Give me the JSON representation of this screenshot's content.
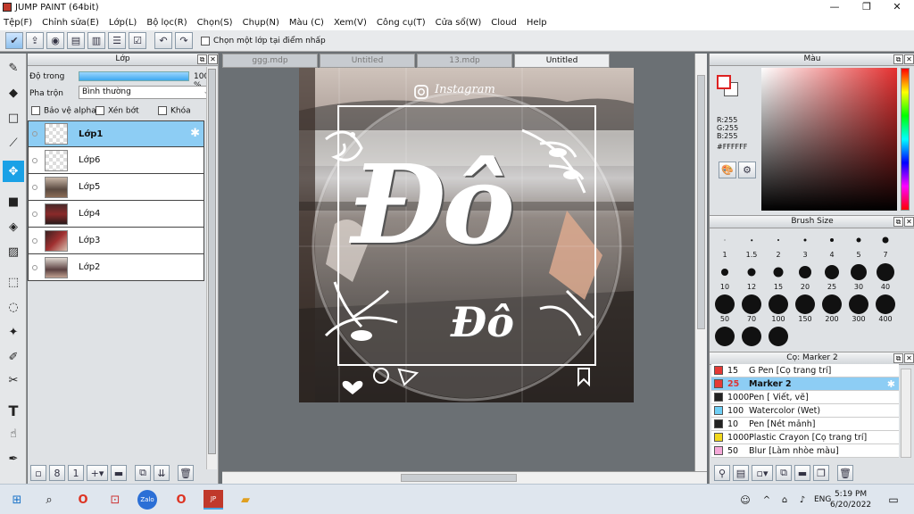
{
  "window": {
    "title": "JUMP PAINT (64bit)",
    "min": "—",
    "max": "❐",
    "close": "✕"
  },
  "menu": [
    "Tệp(F)",
    "Chỉnh sửa(E)",
    "Lớp(L)",
    "Bộ lọc(R)",
    "Chọn(S)",
    "Chụp(N)",
    "Màu (C)",
    "Xem(V)",
    "Công cụ(T)",
    "Cửa sổ(W)",
    "Cloud",
    "Help"
  ],
  "toolbar": {
    "select_layer_label": "Chọn một lớp tại điểm nhấp"
  },
  "layer_panel": {
    "title": "Lớp",
    "opacity_label": "Độ trong",
    "opacity_value": "100 %",
    "opacity_fraction": 1.0,
    "blend_label": "Pha trộn",
    "blend_value": "Bình thường",
    "protect_alpha": "Bảo vệ alpha",
    "clip": "Xén bớt",
    "lock": "Khóa",
    "layers": [
      "Lớp1",
      "Lớp6",
      "Lớp5",
      "Lớp4",
      "Lớp3",
      "Lớp2"
    ],
    "selected_layer": "Lớp1"
  },
  "tabs": [
    "ggg.mdp",
    "Untitled",
    "13.mdp",
    "Untitled"
  ],
  "active_tab": 3,
  "canvas": {
    "instagram": "Instagram",
    "big_text": "Đô",
    "small_text": "Đô"
  },
  "color_panel": {
    "title": "Màu",
    "r": "R:255",
    "g": "G:255",
    "b": "B:255",
    "hex": "#FFFFFF",
    "foreground": "#ffffff",
    "background": "#ffffff"
  },
  "brush_size": {
    "title": "Brush Size",
    "sizes": [
      "1",
      "1.5",
      "2",
      "3",
      "4",
      "5",
      "7",
      "10",
      "12",
      "15",
      "20",
      "25",
      "30",
      "40",
      "50",
      "70",
      "100",
      "150",
      "200",
      "300",
      "400"
    ]
  },
  "brushes": {
    "title": "Cọ: Marker 2",
    "items": [
      {
        "size": "15",
        "name": "G Pen [Cọ trang trí]",
        "color": "#e53935"
      },
      {
        "size": "25",
        "name": "Marker 2",
        "color": "#e53935"
      },
      {
        "size": "1000",
        "name": "Pen [ Viết, vẽ]",
        "color": "#222222"
      },
      {
        "size": "100",
        "name": "Watercolor (Wet)",
        "color": "#6ecff6"
      },
      {
        "size": "10",
        "name": "Pen [Nét mảnh]",
        "color": "#222222"
      },
      {
        "size": "1000",
        "name": "Plastic Crayon [Cọ trang trí]",
        "color": "#f2d81c"
      },
      {
        "size": "50",
        "name": "Blur [Làm nhòe màu]",
        "color": "#f5a8d8"
      }
    ],
    "selected": 1
  },
  "taskbar": {
    "time": "5:19 PM",
    "date": "6/20/2022",
    "lang": "ENG"
  }
}
